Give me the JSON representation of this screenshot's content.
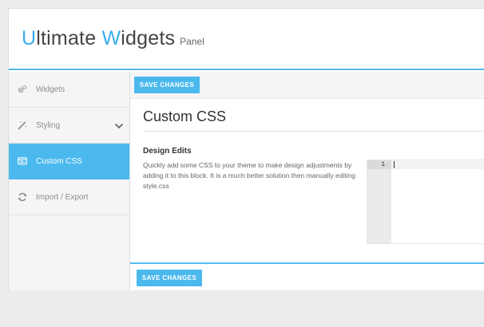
{
  "header": {
    "title_initial_1": "U",
    "title_rest_1": "ltimate ",
    "title_initial_2": "W",
    "title_rest_2": "idgets",
    "subtitle": "Panel"
  },
  "sidebar": {
    "items": [
      {
        "label": "Widgets",
        "icon": "gears-icon",
        "active": false
      },
      {
        "label": "Styling",
        "icon": "magic-wand-icon",
        "active": false,
        "expandable": true
      },
      {
        "label": "Custom CSS",
        "icon": "code-window-icon",
        "active": true
      },
      {
        "label": "Import / Export",
        "icon": "refresh-icon",
        "active": false
      }
    ]
  },
  "toolbar": {
    "save_label_top": "SAVE CHANGES",
    "save_label_bottom": "SAVE CHANGES"
  },
  "section": {
    "title": "Custom CSS",
    "field_label": "Design Edits",
    "field_description": "Quickly add some CSS to your theme to make design adjustments by adding it to this block. It is a much better solution then manually editing style.css"
  },
  "editor": {
    "line_number": "1",
    "content": ""
  },
  "colors": {
    "accent": "#4bb9ee",
    "logo_accent": "#3dacea",
    "sidebar_bg": "#f5f5f5"
  }
}
